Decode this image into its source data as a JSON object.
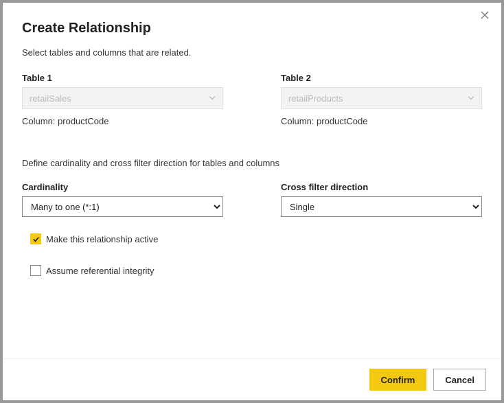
{
  "dialog": {
    "title": "Create Relationship",
    "subtitle": "Select tables and columns that are related.",
    "section2_intro": "Define cardinality and cross filter direction for tables and columns"
  },
  "table1": {
    "label": "Table 1",
    "value": "retailSales",
    "column_prefix": "Column: ",
    "column_value": "productCode"
  },
  "table2": {
    "label": "Table 2",
    "value": "retailProducts",
    "column_prefix": "Column: ",
    "column_value": "productCode"
  },
  "cardinality": {
    "label": "Cardinality",
    "value": "Many to one (*:1)"
  },
  "crossfilter": {
    "label": "Cross filter direction",
    "value": "Single"
  },
  "options": {
    "active_label": "Make this relationship active",
    "referential_label": "Assume referential integrity"
  },
  "footer": {
    "confirm": "Confirm",
    "cancel": "Cancel"
  }
}
